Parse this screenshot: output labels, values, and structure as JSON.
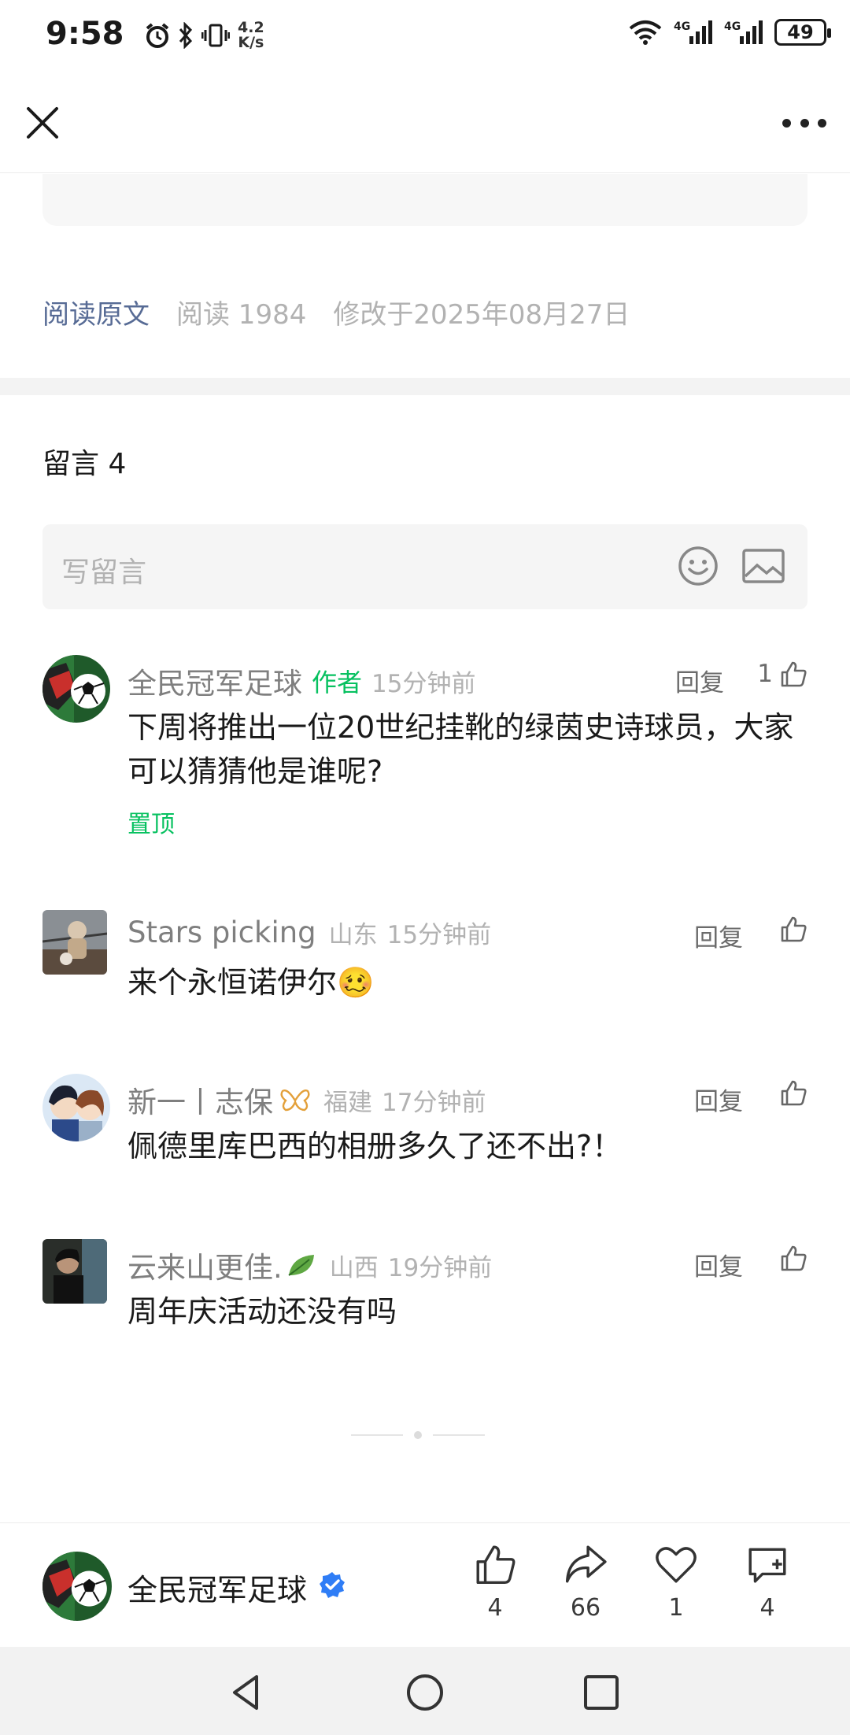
{
  "status_bar": {
    "time": "9:58",
    "speed_value": "4.2",
    "speed_unit": "K/s",
    "network1": "4G",
    "network2": "4G",
    "battery": "49"
  },
  "article": {
    "read_original": "阅读原文",
    "reads": "阅读 1984",
    "modified": "修改于2025年08月27日"
  },
  "comments_section": {
    "title": "留言 4",
    "input_placeholder": "写留言"
  },
  "comments": [
    {
      "name": "全民冠军足球",
      "author_tag": "作者",
      "location": "",
      "time": "15分钟前",
      "reply": "回复",
      "likes": "1",
      "text": "下周将推出一位20世纪挂靴的绿茵史诗球员，大家可以猜猜他是谁呢?",
      "pinned": "置顶"
    },
    {
      "name": "Stars picking",
      "location": "山东",
      "time": "15分钟前",
      "reply": "回复",
      "likes": "",
      "text": "来个永恒诺伊尔🥴"
    },
    {
      "name": "新一丨志保",
      "location": "福建",
      "time": "17分钟前",
      "reply": "回复",
      "likes": "",
      "text": "佩德里库巴西的相册多久了还不出?！"
    },
    {
      "name": "云来山更佳.",
      "location": "山西",
      "time": "19分钟前",
      "reply": "回复",
      "likes": "",
      "text": "周年庆活动还没有吗"
    }
  ],
  "bottom_bar": {
    "account_name": "全民冠军足球",
    "likes": "4",
    "shares": "66",
    "favorites": "1",
    "comments": "4"
  },
  "colors": {
    "link": "#576b95",
    "green": "#07c160",
    "verified": "#2f7df6"
  }
}
